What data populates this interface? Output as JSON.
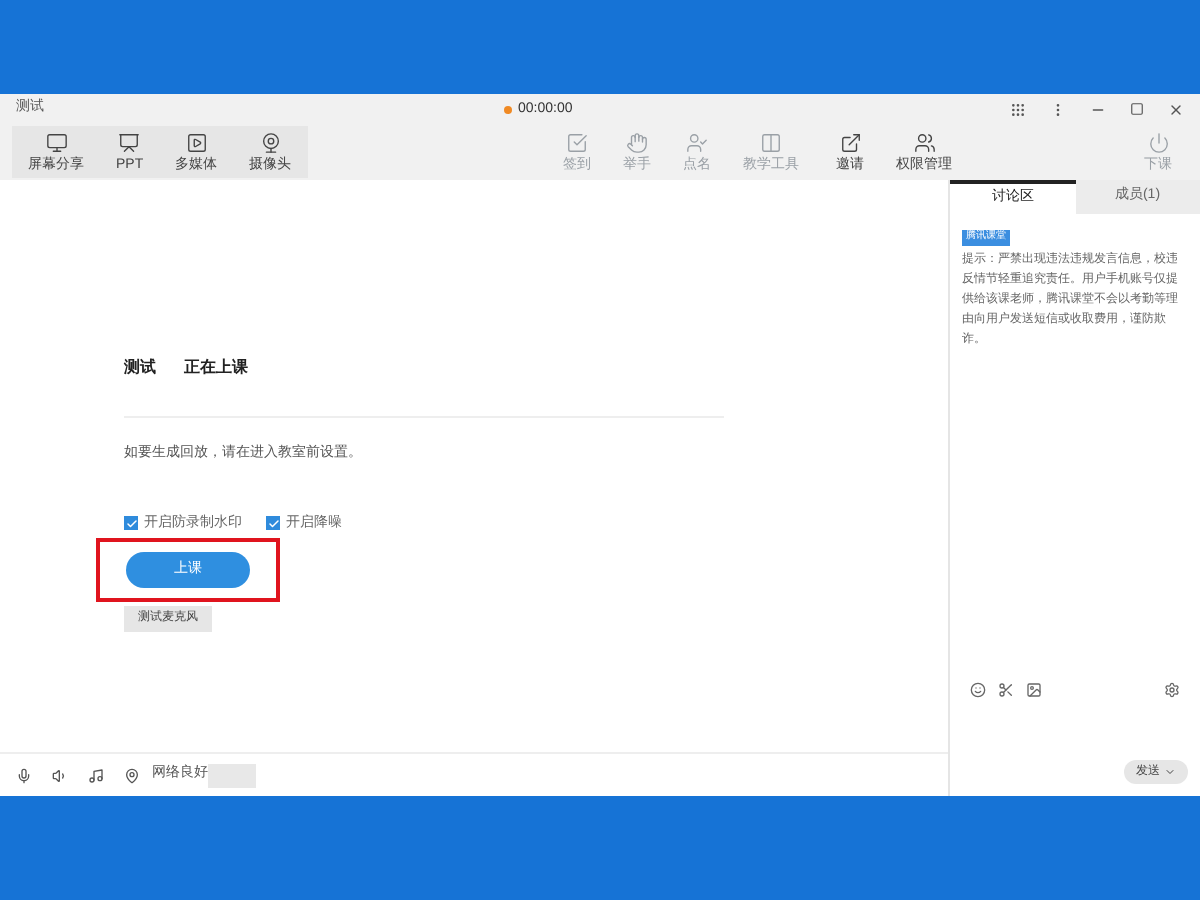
{
  "window": {
    "title": "测试",
    "timer": "00:00:00"
  },
  "toolbar_left": [
    {
      "label": "屏幕分享",
      "kind": "monitor"
    },
    {
      "label": "PPT",
      "kind": "ppt"
    },
    {
      "label": "多媒体",
      "kind": "play"
    },
    {
      "label": "摄像头",
      "kind": "camera"
    }
  ],
  "toolbar_center": [
    {
      "label": "签到",
      "kind": "check"
    },
    {
      "label": "举手",
      "kind": "hand"
    },
    {
      "label": "点名",
      "kind": "badge"
    },
    {
      "label": "教学工具",
      "kind": "tools"
    }
  ],
  "toolbar_right": [
    {
      "label": "邀请",
      "kind": "share"
    },
    {
      "label": "权限管理",
      "kind": "users"
    },
    {
      "label": "下课",
      "kind": "power"
    }
  ],
  "course": {
    "name": "测试",
    "status": "正在上课",
    "notice": "如要生成回放，请在进入教室前设置。"
  },
  "options": [
    {
      "label": "开启防录制水印",
      "checked": true
    },
    {
      "label": "开启降噪",
      "checked": true
    }
  ],
  "start_button": "上课",
  "mic_test_button": "测试麦克风",
  "tabs": [
    {
      "label": "讨论区",
      "selected": true
    },
    {
      "label": "成员(1)",
      "selected": false
    }
  ],
  "chat": {
    "badge": "腾讯课堂",
    "message": "提示：严禁出现违法违规发言信息，校违反情节轻重追究责任。用户手机账号仅提供给该课老师，腾讯课堂不会以考勤等理由向用户发送短信或收取费用，谨防欺诈。",
    "send_button": "发送"
  },
  "status_bar": {
    "network": "网络良好"
  }
}
